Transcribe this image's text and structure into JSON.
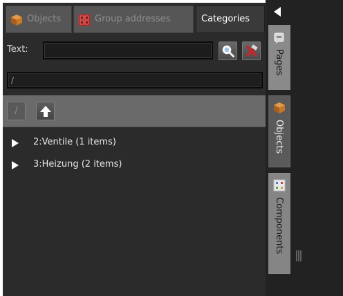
{
  "tabs": {
    "objects": "Objects",
    "group_addresses": "Group addresses",
    "categories": "Categories"
  },
  "search": {
    "label": "Text:",
    "value": ""
  },
  "path": {
    "value": "/"
  },
  "nav": {
    "root_label": "/"
  },
  "categories": [
    {
      "label": "2:Ventile (1 items)"
    },
    {
      "label": "3:Heizung (2 items)"
    }
  ],
  "side_tabs": {
    "pages": "Pages",
    "objects": "Objects",
    "components": "Components"
  },
  "icons": {
    "objects_tab": "box-icon",
    "groups_tab": "grid-icon",
    "search": "search-icon",
    "clear": "clear-icon",
    "up": "up-arrow-icon",
    "expander": "expand-triangle-icon",
    "collapse": "collapse-arrow-icon"
  },
  "colors": {
    "panel_bg": "#2b2b2b",
    "tab_active_text": "#ffffff",
    "tab_inactive_text": "#8e8e8e",
    "clear_accent": "#c0282a",
    "box_orange": "#c8782a"
  }
}
